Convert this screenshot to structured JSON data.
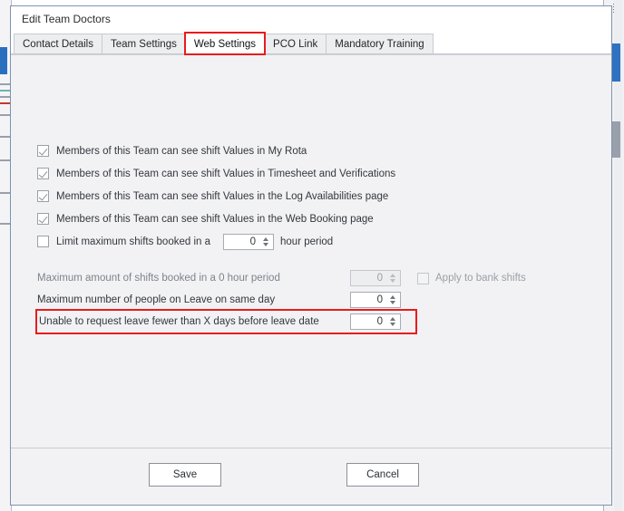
{
  "dialog": {
    "title": "Edit Team Doctors",
    "tabs": [
      {
        "label": "Contact Details",
        "active": false,
        "highlight": false
      },
      {
        "label": "Team Settings",
        "active": false,
        "highlight": false
      },
      {
        "label": "Web Settings",
        "active": true,
        "highlight": true
      },
      {
        "label": "PCO Link",
        "active": false,
        "highlight": false
      },
      {
        "label": "Mandatory Training",
        "active": false,
        "highlight": false
      }
    ],
    "checkboxes": [
      {
        "label": "Members of this Team can see shift Values in My Rota",
        "checked": true
      },
      {
        "label": "Members of this Team can see shift Values in Timesheet and Verifications",
        "checked": true
      },
      {
        "label": "Members of this Team can see shift Values in the Log Availabilities page",
        "checked": true
      },
      {
        "label": "Members of this Team can see shift Values in the Web Booking page",
        "checked": true
      }
    ],
    "limit_row": {
      "label": "Limit maximum shifts booked in a",
      "checked": false,
      "value": "0",
      "suffix": "hour period"
    },
    "numeric_rows": [
      {
        "label": "Maximum amount of shifts booked in a 0 hour period",
        "value": "0",
        "disabled": true,
        "highlighted": false,
        "extra_checkbox": {
          "label": "Apply to bank shifts",
          "checked": false
        }
      },
      {
        "label": "Maximum number of people on Leave on same day",
        "value": "0",
        "disabled": false,
        "highlighted": false,
        "extra_checkbox": null
      },
      {
        "label": "Unable to request leave fewer than X days before leave date",
        "value": "0",
        "disabled": false,
        "highlighted": true,
        "extra_checkbox": null
      }
    ],
    "footer": {
      "save_label": "Save",
      "cancel_label": "Cancel"
    },
    "colors": {
      "highlight": "#e81c1c",
      "dialog_bg": "#f2f2f5",
      "accent_blue": "#2f72c0"
    }
  }
}
